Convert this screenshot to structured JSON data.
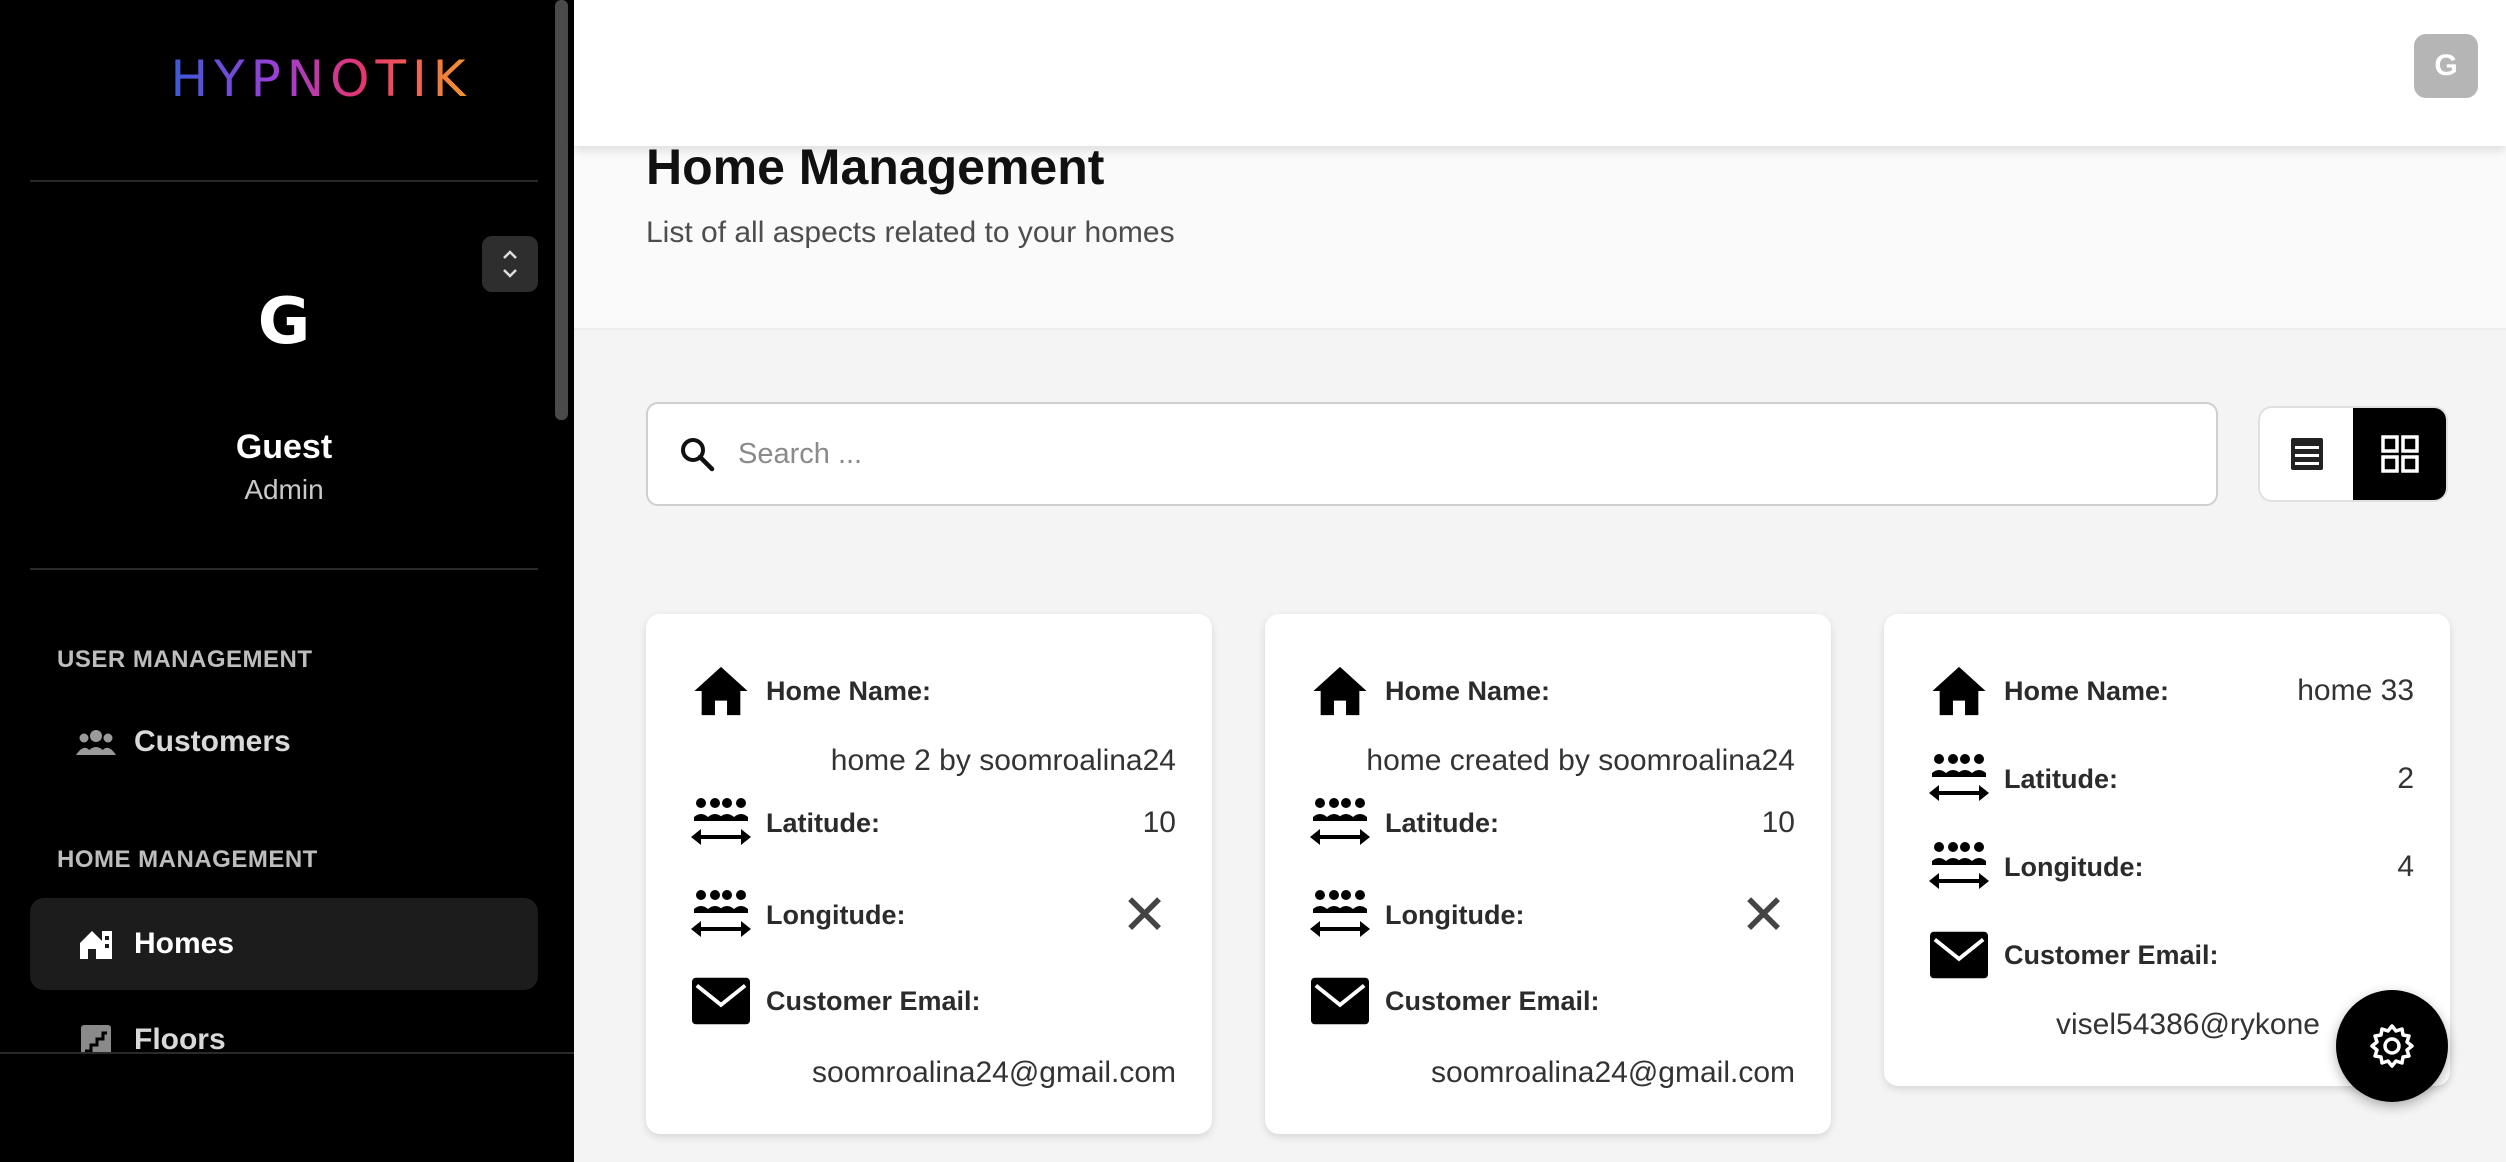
{
  "brand": {
    "logo_text": "HYPNOTIK"
  },
  "user": {
    "initial": "G",
    "name": "Guest",
    "role": "Admin"
  },
  "sidebar": {
    "sections": [
      {
        "title": "USER MANAGEMENT",
        "items": [
          {
            "label": "Customers",
            "icon": "users-icon",
            "active": false
          }
        ]
      },
      {
        "title": "HOME MANAGEMENT",
        "items": [
          {
            "label": "Homes",
            "icon": "home-icon",
            "active": true
          },
          {
            "label": "Floors",
            "icon": "stairs-icon",
            "active": false
          }
        ]
      }
    ]
  },
  "header": {
    "avatar_initial": "G"
  },
  "page": {
    "title": "Home Management",
    "subtitle": "List of all aspects related to your homes"
  },
  "search": {
    "placeholder": "Search ...",
    "value": ""
  },
  "view_toggle": {
    "list_icon": "list-view-icon",
    "grid_icon": "grid-view-icon",
    "selected": "grid"
  },
  "labels": {
    "home_name": "Home Name:",
    "latitude": "Latitude:",
    "longitude": "Longitude:",
    "customer_email": "Customer Email:"
  },
  "cards": [
    {
      "home_name": "home 2 by soomroalina24",
      "latitude": "10",
      "longitude": "✕",
      "customer_email": "soomroalina24@gmail.com"
    },
    {
      "home_name": "home created by soomroalina24",
      "latitude": "10",
      "longitude": "✕",
      "customer_email": "soomroalina24@gmail.com"
    },
    {
      "home_name": "home 33",
      "latitude": "2",
      "longitude": "4",
      "customer_email": "visel54386@rykone"
    }
  ],
  "fab": {
    "icon": "settings-gear-icon"
  },
  "colors": {
    "sidebar_bg": "#000000",
    "accent": "#000000",
    "page_bg": "#f4f4f4"
  }
}
